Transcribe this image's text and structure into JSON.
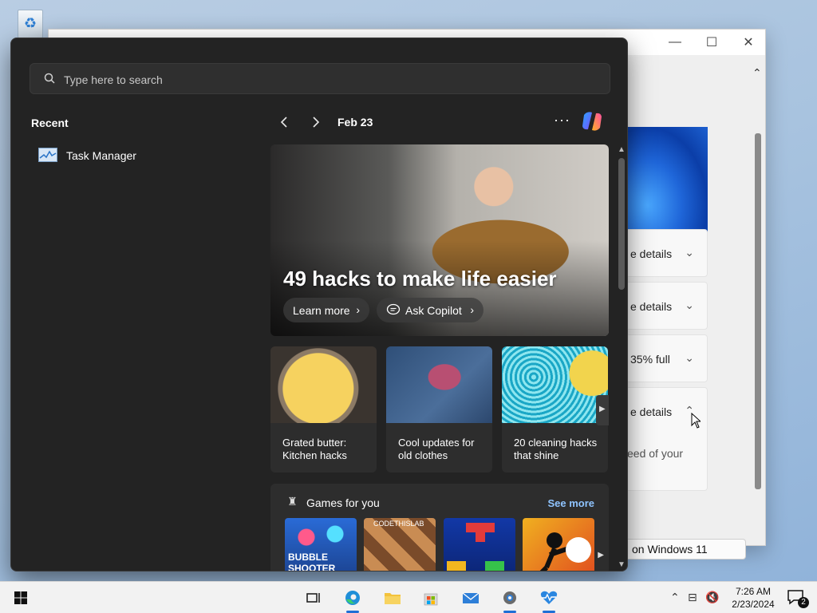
{
  "start": {
    "search": {
      "placeholder": "Type here to search"
    },
    "recent": {
      "title": "Recent",
      "items": [
        {
          "label": "Task Manager",
          "icon": "task-manager-icon"
        }
      ]
    },
    "feed": {
      "date": "Feb 23",
      "more_label": "···",
      "hero": {
        "headline": "49 hacks to make life easier",
        "learn_more": "Learn more",
        "ask_copilot": "Ask Copilot"
      },
      "cards": [
        {
          "title": "Grated butter: Kitchen hacks"
        },
        {
          "title": "Cool updates for old clothes"
        },
        {
          "title": "20 cleaning hacks that shine"
        }
      ],
      "games": {
        "title": "Games for you",
        "see_more": "See more",
        "tiles": [
          {
            "label": "BUBBLE SHOOTER"
          },
          {
            "label": "CODETHISLAB"
          },
          {
            "label": ""
          },
          {
            "label": ""
          }
        ]
      }
    }
  },
  "background_window": {
    "rows": [
      "e details",
      "e details",
      "35% full",
      "e details"
    ],
    "sub_text": "eed of your",
    "button_label": "on Windows 11"
  },
  "taskbar": {
    "apps": [
      "task-view-icon",
      "edge-icon",
      "file-explorer-icon",
      "store-icon",
      "mail-icon",
      "settings-icon",
      "health-icon"
    ],
    "clock": {
      "time": "7:26 AM",
      "date": "2/23/2024"
    },
    "notifications_count": "2"
  },
  "colors": {
    "start_bg": "#232323",
    "accent": "#1f6fd6",
    "link": "#8fc4ff"
  }
}
